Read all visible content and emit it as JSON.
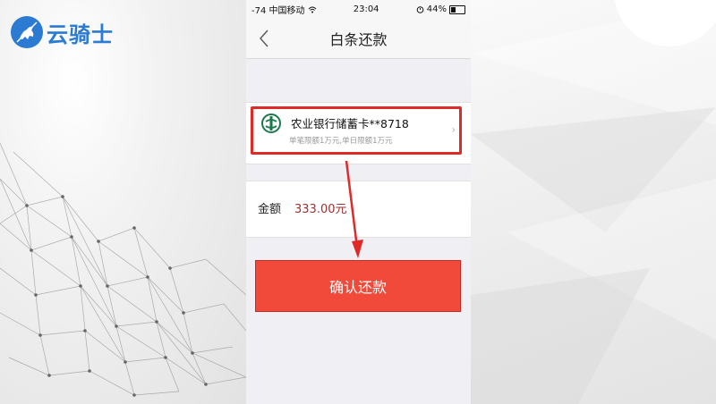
{
  "brand": {
    "name": "云骑士",
    "color": "#2a7bd1"
  },
  "status_bar": {
    "carrier": "-74 中国移动",
    "time": "23:04",
    "battery": "44%",
    "battery_level": 0.44
  },
  "nav": {
    "title": "白条还款",
    "back_icon": "chevron-left-icon"
  },
  "card": {
    "bank_name": "农业银行储蓄卡**8718",
    "limit_text": "单笔限额1万元,单日限额1万元",
    "icon": "abc-bank-icon",
    "highlight_color": "#e02a2a"
  },
  "amount": {
    "label": "金额",
    "value": "333.00元"
  },
  "confirm_button": {
    "label": "确认还款",
    "color": "#f24a3a"
  }
}
